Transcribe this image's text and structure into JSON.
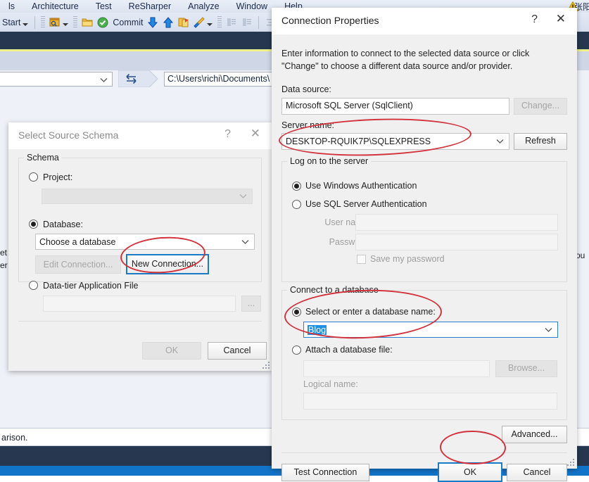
{
  "ide": {
    "menubar": [
      {
        "label": "ls",
        "accel": ""
      },
      {
        "label": "Architecture",
        "accel": "c"
      },
      {
        "label": "Test",
        "accel": "s"
      },
      {
        "label": "ReSharper",
        "accel": "R"
      },
      {
        "label": "Analyze",
        "accel": "A"
      },
      {
        "label": "Window",
        "accel": "W"
      },
      {
        "label": "Help",
        "accel": "H"
      }
    ],
    "toolbar": {
      "start_label": "Start",
      "commit_label": "Commit",
      "icons": [
        "search-window-icon",
        "folder-icon",
        "commit-check-icon",
        "download-arrow-icon",
        "upload-arrow-icon",
        "refactor-icon",
        "tools-hammer-icon",
        "comment-lines-icon",
        "uncomment-lines-icon",
        "indent-icon",
        "outdent-icon"
      ]
    },
    "compare_bar": {
      "left_combo_value": "",
      "swap_icon": "swap-arrows-icon",
      "path_value": "C:\\Users\\richi\\Documents\\"
    },
    "edge_text_left_1": "et",
    "edge_text_left_2": "er",
    "edge_text_right": "ou",
    "status_line": "arison.",
    "tray_text": "张阳",
    "warning_icon": "warning-triangle-icon"
  },
  "schema_dialog": {
    "title": "Select Source Schema",
    "help_label": "?",
    "close_label": "✕",
    "group_label": "Schema",
    "project": {
      "radio_label": "Project:",
      "selected": false,
      "combo_value": "",
      "combo_enabled": false
    },
    "database": {
      "radio_label": "Database:",
      "selected": true,
      "combo_value": "Choose a database",
      "edit_connection_label": "Edit Connection...",
      "edit_connection_enabled": false,
      "new_connection_label": "New Connection...",
      "new_connection_default": true
    },
    "dac": {
      "radio_label": "Data-tier Application File",
      "selected": false,
      "path_value": "",
      "browse_label": "..."
    },
    "buttons": {
      "ok_label": "OK",
      "ok_enabled": false,
      "cancel_label": "Cancel"
    }
  },
  "connection_dialog": {
    "title": "Connection Properties",
    "help_label": "?",
    "close_label": "✕",
    "description": "Enter information to connect to the selected data source or click \"Change\" to choose a different data source and/or provider.",
    "data_source": {
      "label": "Data source:",
      "value": "Microsoft SQL Server (SqlClient)",
      "change_label": "Change...",
      "change_enabled": false
    },
    "server_name": {
      "label": "Server name:",
      "value": "DESKTOP-RQUIK7P\\SQLEXPRESS",
      "refresh_label": "Refresh"
    },
    "logon": {
      "group_label": "Log on to the server",
      "windows_auth_label": "Use Windows Authentication",
      "windows_auth_selected": true,
      "sql_auth_label": "Use SQL Server Authentication",
      "sql_auth_selected": false,
      "user_name_label": "User name:",
      "user_name_value": "",
      "password_label": "Password:",
      "password_value": "",
      "save_password_label": "Save my password",
      "save_password_checked": false
    },
    "connect_db": {
      "group_label": "Connect to a database",
      "select_label": "Select or enter a database name:",
      "select_selected": true,
      "database_value": "Blog",
      "database_value_selected": true,
      "attach_label": "Attach a database file:",
      "attach_selected": false,
      "attach_path_value": "",
      "browse_label": "Browse...",
      "logical_name_label": "Logical name:",
      "logical_name_value": ""
    },
    "advanced_label": "Advanced...",
    "buttons": {
      "test_connection_label": "Test Connection",
      "ok_label": "OK",
      "ok_default": true,
      "cancel_label": "Cancel"
    }
  },
  "annotations": {
    "accent_color": "#d2323c",
    "marks": [
      {
        "name": "server-name-highlight"
      },
      {
        "name": "new-connection-highlight"
      },
      {
        "name": "database-name-highlight"
      },
      {
        "name": "ok-button-highlight"
      }
    ]
  }
}
